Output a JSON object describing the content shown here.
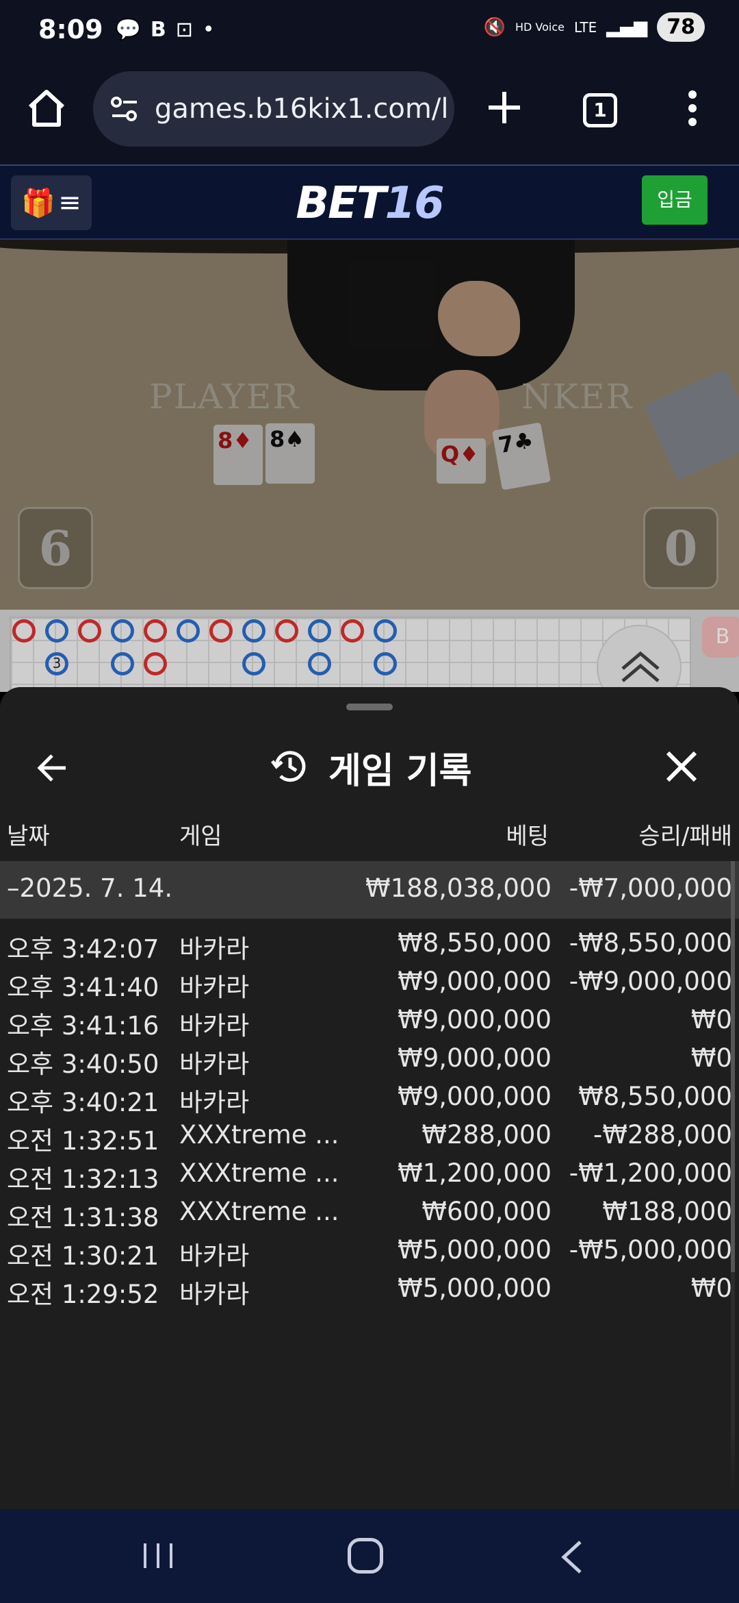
{
  "status": {
    "time": "8:09",
    "battery": "78",
    "network": "LTE",
    "hd_voice": "HD Voice"
  },
  "browser": {
    "url": "games.b16kix1.com/l",
    "tab_count": "1"
  },
  "site": {
    "logo_part1": "BET",
    "logo_part2": "16",
    "deposit_label": "입금"
  },
  "game_view": {
    "player_label": "PLAYER",
    "banker_label": "NKER",
    "player_score": "6",
    "banker_score": "0",
    "player_cards": [
      "8♦",
      "8♠"
    ],
    "banker_cards": [
      "Q♦",
      "7♣"
    ],
    "road_badge": "3",
    "road_side_label": "B"
  },
  "sheet": {
    "title": "게임 기록",
    "columns": {
      "date": "날짜",
      "game": "게임",
      "bet": "베팅",
      "result": "승리/패배"
    },
    "summary": {
      "date": "–2025. 7. 14.",
      "bet": "₩188,038,000",
      "result": "-₩7,000,000"
    },
    "rows": [
      {
        "time": "오후 3:42:07",
        "game": "바카라",
        "bet": "₩8,550,000",
        "result": "-₩8,550,000"
      },
      {
        "time": "오후 3:41:40",
        "game": "바카라",
        "bet": "₩9,000,000",
        "result": "-₩9,000,000"
      },
      {
        "time": "오후 3:41:16",
        "game": "바카라",
        "bet": "₩9,000,000",
        "result": "₩0"
      },
      {
        "time": "오후 3:40:50",
        "game": "바카라",
        "bet": "₩9,000,000",
        "result": "₩0"
      },
      {
        "time": "오후 3:40:21",
        "game": "바카라",
        "bet": "₩9,000,000",
        "result": "₩8,550,000"
      },
      {
        "time": "오전 1:32:51",
        "game": "XXXtreme ...",
        "bet": "₩288,000",
        "result": "-₩288,000"
      },
      {
        "time": "오전 1:32:13",
        "game": "XXXtreme ...",
        "bet": "₩1,200,000",
        "result": "-₩1,200,000"
      },
      {
        "time": "오전 1:31:38",
        "game": "XXXtreme ...",
        "bet": "₩600,000",
        "result": "₩188,000"
      },
      {
        "time": "오전 1:30:21",
        "game": "바카라",
        "bet": "₩5,000,000",
        "result": "-₩5,000,000"
      },
      {
        "time": "오전 1:29:52",
        "game": "바카라",
        "bet": "₩5,000,000",
        "result": "₩0"
      }
    ]
  }
}
